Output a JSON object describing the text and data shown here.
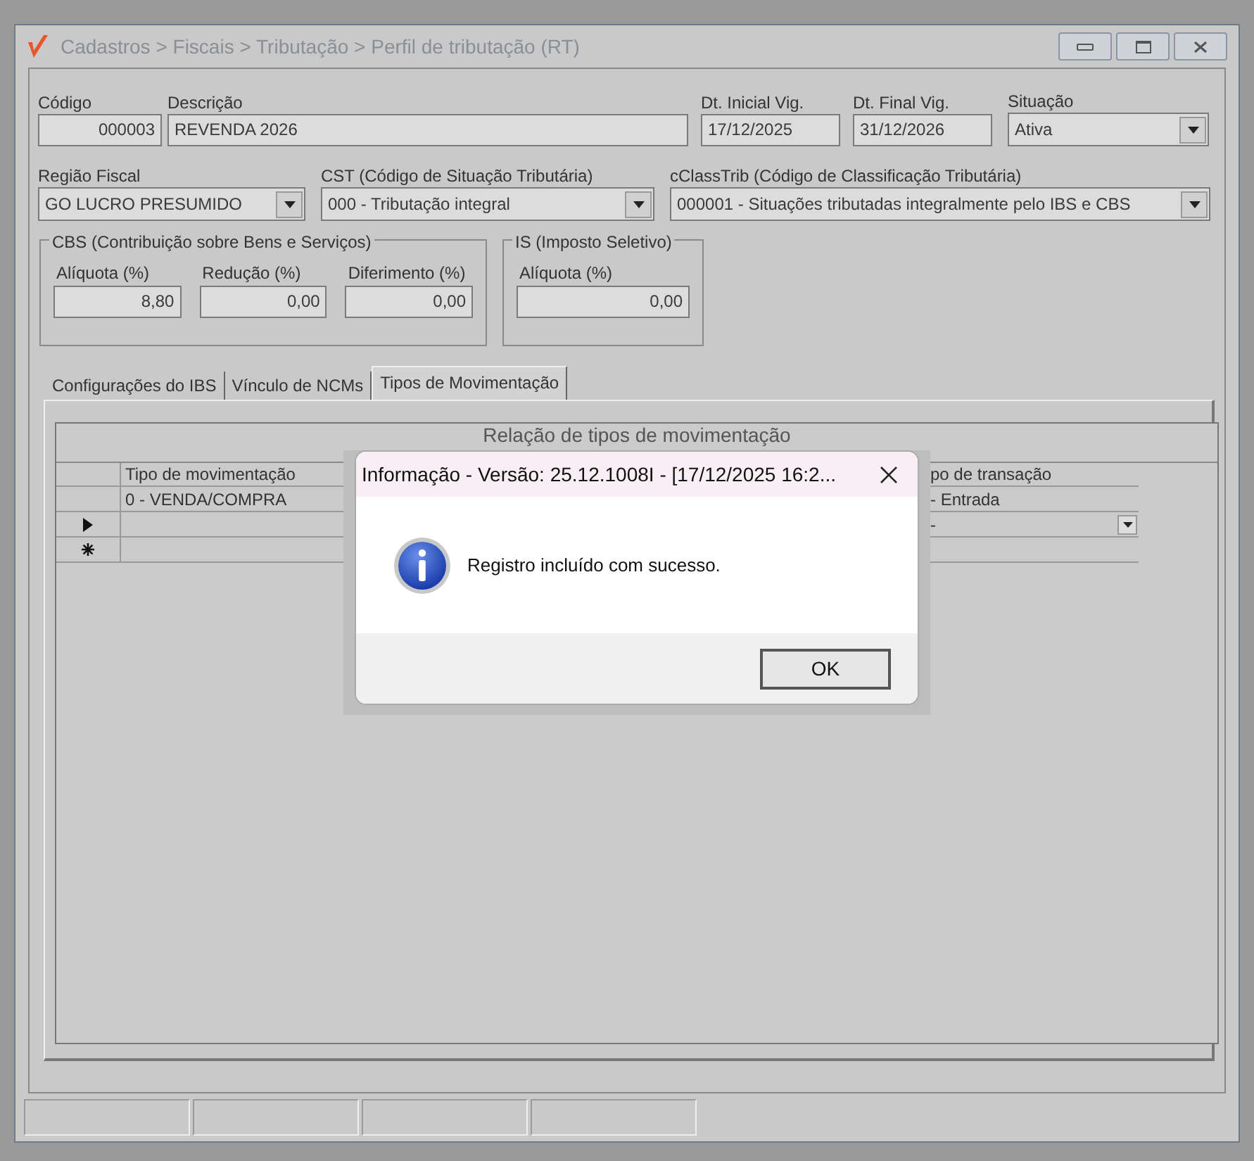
{
  "window": {
    "title": "Cadastros > Fiscais > Tributação > Perfil de tributação (RT)"
  },
  "header": {
    "codigo": {
      "label": "Código",
      "value": "000003"
    },
    "descricao": {
      "label": "Descrição",
      "value": "REVENDA 2026"
    },
    "dt_inicial": {
      "label": "Dt. Inicial Vig.",
      "value": "17/12/2025"
    },
    "dt_final": {
      "label": "Dt. Final Vig.",
      "value": "31/12/2026"
    },
    "situacao": {
      "label": "Situação",
      "value": "Ativa"
    }
  },
  "classificacao": [
    {
      "label": "Região Fiscal",
      "value": "GO LUCRO PRESUMIDO"
    },
    {
      "label": "CST (Código de Situação Tributária)",
      "value": "000 - Tributação integral"
    },
    {
      "label": "cClassTrib (Código de Classificação Tributária)",
      "value": "000001 - Situações tributadas integralmente pelo IBS e CBS"
    }
  ],
  "groups": [
    {
      "title": "CBS (Contribuição sobre Bens e Serviços)",
      "fields": [
        {
          "label": "Alíquota (%)",
          "value": "8,80"
        },
        {
          "label": "Redução (%)",
          "value": "0,00"
        },
        {
          "label": "Diferimento (%)",
          "value": "0,00"
        }
      ]
    },
    {
      "title": "IS (Imposto Seletivo)",
      "fields": [
        {
          "label": "Alíquota (%)",
          "value": "0,00"
        }
      ]
    }
  ],
  "tabs": [
    {
      "label": "Configurações do IBS",
      "selected": false
    },
    {
      "label": "Vínculo de NCMs",
      "selected": false
    },
    {
      "label": "Tipos de Movimentação",
      "selected": true
    }
  ],
  "grid": {
    "caption": "Relação de tipos de movimentação",
    "columns": [
      "Tipo de movimentação",
      "po de transação"
    ],
    "rows": [
      {
        "kind": "data",
        "cells": [
          "0 - VENDA/COMPRA",
          "- Entrada"
        ]
      },
      {
        "kind": "current",
        "cells": [
          "",
          "-"
        ]
      },
      {
        "kind": "new",
        "cells": [
          "",
          ""
        ]
      }
    ]
  },
  "dialog": {
    "title": "Informação - Versão: 25.12.1008I - [17/12/2025 16:2...",
    "message": "Registro incluído com sucesso.",
    "button": "OK"
  }
}
